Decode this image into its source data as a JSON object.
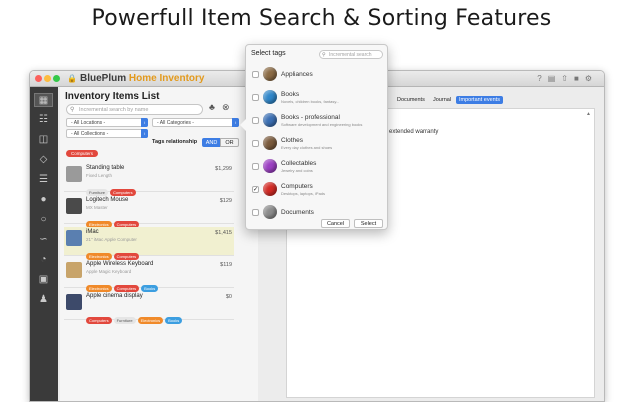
{
  "headline": "Powerfull Item Search & Sorting Features",
  "window": {
    "app_name_part1": "BluePlum",
    "app_name_part2": "Home Inventory",
    "toolbar_icons": [
      "help-icon",
      "document-icon",
      "share-icon",
      "lock-icon",
      "gear-icon"
    ]
  },
  "sidebar": {
    "icons": [
      "inventory-icon",
      "location-icon",
      "rooms-icon",
      "tags-icon",
      "stack-icon",
      "pin-icon",
      "warranty-icon",
      "chart-icon",
      "pie-icon",
      "contacts-icon",
      "user-icon"
    ]
  },
  "list": {
    "title": "Inventory Items List",
    "search_placeholder": "Incremental search by name",
    "locations_select": "- All Locations -",
    "categories_select": "- All Categories -",
    "collections_select": "- All Collections -",
    "tags_relationship_label": "Tags relationship",
    "and_label": "AND",
    "or_label": "OR",
    "active_filter_tag": "Computers",
    "items": [
      {
        "name": "Standing table",
        "sub": "Fixed Length",
        "price": "$1,299",
        "tags": [
          {
            "label": "Furniture",
            "color": "#e5e5e5",
            "text": "#555"
          },
          {
            "label": "Computers",
            "color": "#e2483d",
            "text": "#fff"
          }
        ]
      },
      {
        "name": "Logitech Mouse",
        "sub": "MX Master",
        "price": "$129",
        "tags": [
          {
            "label": "Electronics",
            "color": "#f08a2a",
            "text": "#fff"
          },
          {
            "label": "Computers",
            "color": "#e2483d",
            "text": "#fff"
          }
        ]
      },
      {
        "name": "iMac",
        "sub": "21\" iMac Apple Computer",
        "price": "$1,415",
        "tags": [
          {
            "label": "Electronics",
            "color": "#f08a2a",
            "text": "#fff"
          },
          {
            "label": "Computers",
            "color": "#e2483d",
            "text": "#fff"
          }
        ]
      },
      {
        "name": "Apple Wireless Keyboard",
        "sub": "Apple Magic Keyboard",
        "price": "$119",
        "tags": [
          {
            "label": "Electronics",
            "color": "#f08a2a",
            "text": "#fff"
          },
          {
            "label": "Computers",
            "color": "#e2483d",
            "text": "#fff"
          },
          {
            "label": "Books",
            "color": "#3c9ee0",
            "text": "#fff"
          }
        ]
      },
      {
        "name": "Apple cinema display",
        "sub": "",
        "price": "$0",
        "tags": [
          {
            "label": "Computers",
            "color": "#e2483d",
            "text": "#fff"
          },
          {
            "label": "Furniture",
            "color": "#e5e5e5",
            "text": "#555"
          },
          {
            "label": "Electronics",
            "color": "#f08a2a",
            "text": "#fff"
          },
          {
            "label": "Books",
            "color": "#3c9ee0",
            "text": "#fff"
          }
        ]
      }
    ]
  },
  "detail": {
    "tabs": [
      "Documents",
      "Journal",
      "Important events"
    ],
    "active_tab": "Important events",
    "warranty_text": "extended warranty"
  },
  "popover": {
    "title": "Select tags",
    "search_placeholder": "Incremental search",
    "tags": [
      {
        "name": "Appliances",
        "desc": "",
        "color": "#8a6a44",
        "checked": false
      },
      {
        "name": "Books",
        "desc": "Novels, children books, fantasy...",
        "color": "#2f86c9",
        "checked": false
      },
      {
        "name": "Books - professional",
        "desc": "Software development and engineering books",
        "color": "#3b6fb3",
        "checked": false
      },
      {
        "name": "Clothes",
        "desc": "Every day clothes and shoes",
        "color": "#7a5a3c",
        "checked": false
      },
      {
        "name": "Collectables",
        "desc": "Jewelry and coins",
        "color": "#9b3fc2",
        "checked": false
      },
      {
        "name": "Computers",
        "desc": "Desktops, laptops, iPads",
        "color": "#d22a24",
        "checked": true
      },
      {
        "name": "Documents",
        "desc": "",
        "color": "#8b8b8b",
        "checked": false
      }
    ],
    "check_mark": "✓",
    "cancel_label": "Cancel",
    "select_label": "Select"
  }
}
